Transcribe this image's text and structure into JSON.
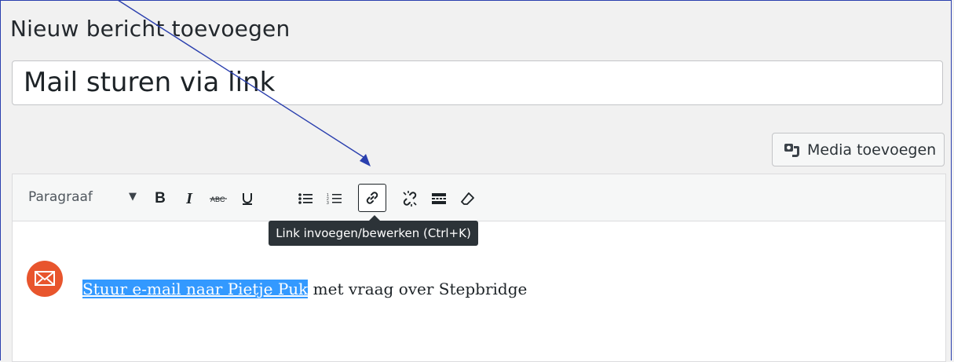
{
  "page": {
    "title": "Nieuw bericht toevoegen"
  },
  "post": {
    "title_value": "Mail sturen via link"
  },
  "media": {
    "button_label": "Media toevoegen",
    "icon": "media-camera-icon"
  },
  "toolbar": {
    "format_select": "Paragraaf",
    "buttons": [
      {
        "name": "bold",
        "icon": "bold-icon"
      },
      {
        "name": "italic",
        "icon": "italic-icon"
      },
      {
        "name": "strikethrough",
        "icon": "strikethrough-icon"
      },
      {
        "name": "underline",
        "icon": "underline-icon"
      },
      {
        "name": "bulleted-list",
        "icon": "bulleted-list-icon"
      },
      {
        "name": "numbered-list",
        "icon": "numbered-list-icon"
      },
      {
        "name": "insert-link",
        "icon": "link-icon",
        "active": true
      },
      {
        "name": "remove-link",
        "icon": "unlink-icon"
      },
      {
        "name": "read-more",
        "icon": "read-more-icon"
      },
      {
        "name": "clear-formatting",
        "icon": "eraser-icon"
      }
    ],
    "tooltip": "Link invoegen/bewerken (Ctrl+K)"
  },
  "content": {
    "selected_text": "Stuur e-mail naar Pietje Puk",
    "rest_text": " met vraag over Stepbridge",
    "icon": "envelope-icon"
  },
  "colors": {
    "accent_selection": "#3399ff",
    "mail_icon_bg": "#e8552d",
    "annotation_arrow": "#2a3fae"
  }
}
